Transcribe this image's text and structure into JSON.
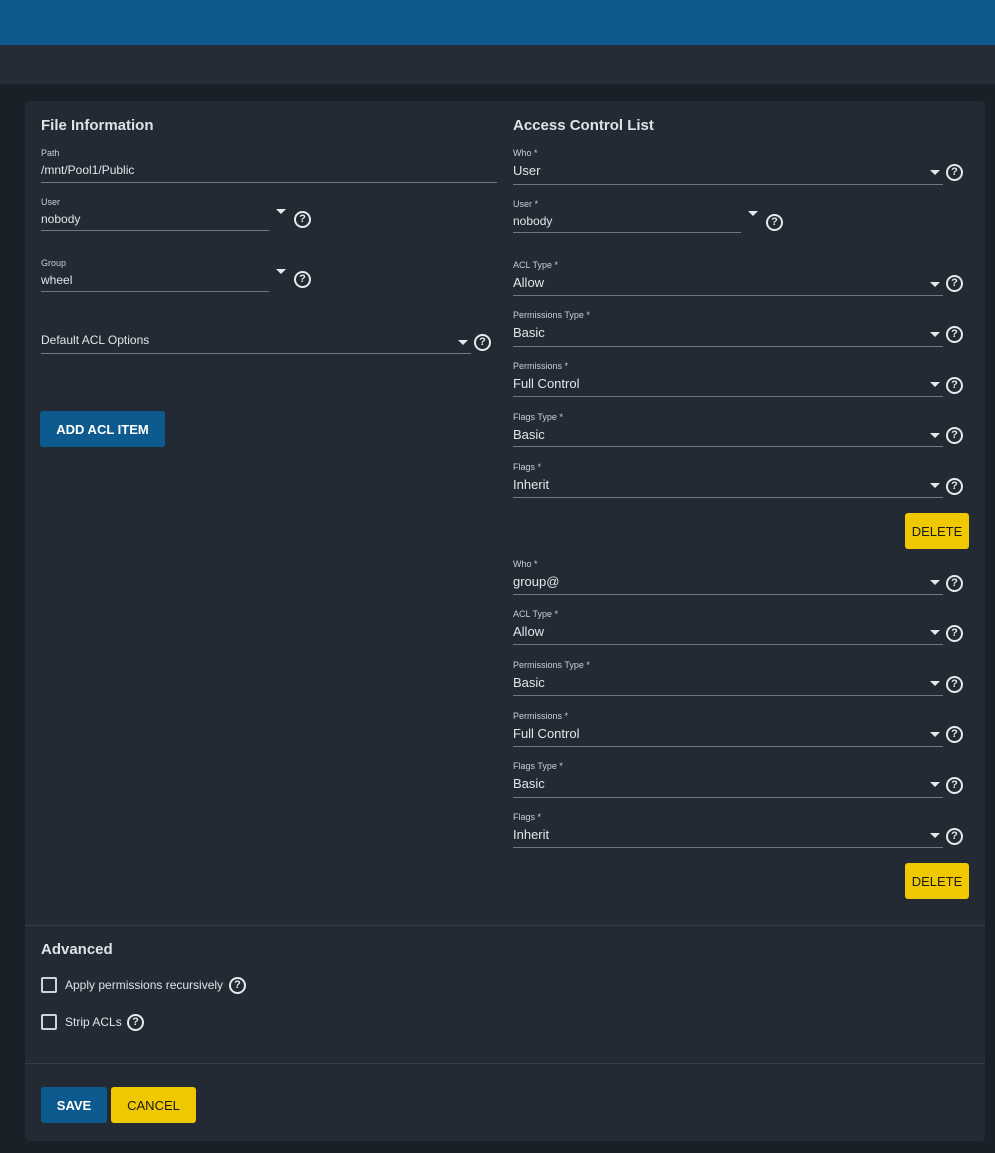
{
  "file_info": {
    "title": "File Information",
    "path": {
      "label": "Path",
      "value": "/mnt/Pool1/Public"
    },
    "user": {
      "label": "User",
      "value": "nobody"
    },
    "group": {
      "label": "Group",
      "value": "wheel"
    },
    "default_acl": {
      "placeholder": "Default ACL Options"
    },
    "add_acl_label": "ADD ACL ITEM"
  },
  "acl": {
    "title": "Access Control List",
    "entries": [
      {
        "who": {
          "label": "Who *",
          "value": "User"
        },
        "user": {
          "label": "User *",
          "value": "nobody"
        },
        "acl_type": {
          "label": "ACL Type *",
          "value": "Allow"
        },
        "perm_type": {
          "label": "Permissions Type *",
          "value": "Basic"
        },
        "perms": {
          "label": "Permissions *",
          "value": "Full Control"
        },
        "flags_type": {
          "label": "Flags Type *",
          "value": "Basic"
        },
        "flags": {
          "label": "Flags *",
          "value": "Inherit"
        },
        "delete_label": "DELETE"
      },
      {
        "who": {
          "label": "Who *",
          "value": "group@"
        },
        "acl_type": {
          "label": "ACL Type *",
          "value": "Allow"
        },
        "perm_type": {
          "label": "Permissions Type *",
          "value": "Basic"
        },
        "perms": {
          "label": "Permissions *",
          "value": "Full Control"
        },
        "flags_type": {
          "label": "Flags Type *",
          "value": "Basic"
        },
        "flags": {
          "label": "Flags *",
          "value": "Inherit"
        },
        "delete_label": "DELETE"
      }
    ]
  },
  "advanced": {
    "title": "Advanced",
    "recursive_label": "Apply permissions recursively",
    "strip_label": "Strip ACLs"
  },
  "actions": {
    "save_label": "SAVE",
    "cancel_label": "CANCEL"
  },
  "icons": {
    "help": "help-circle-icon",
    "dropdown": "caret-down-icon",
    "help_glyph": "?"
  },
  "colors": {
    "primary": "#0d5a8e",
    "warn": "#f0c800",
    "card": "#232a33",
    "background": "#1a2027"
  }
}
